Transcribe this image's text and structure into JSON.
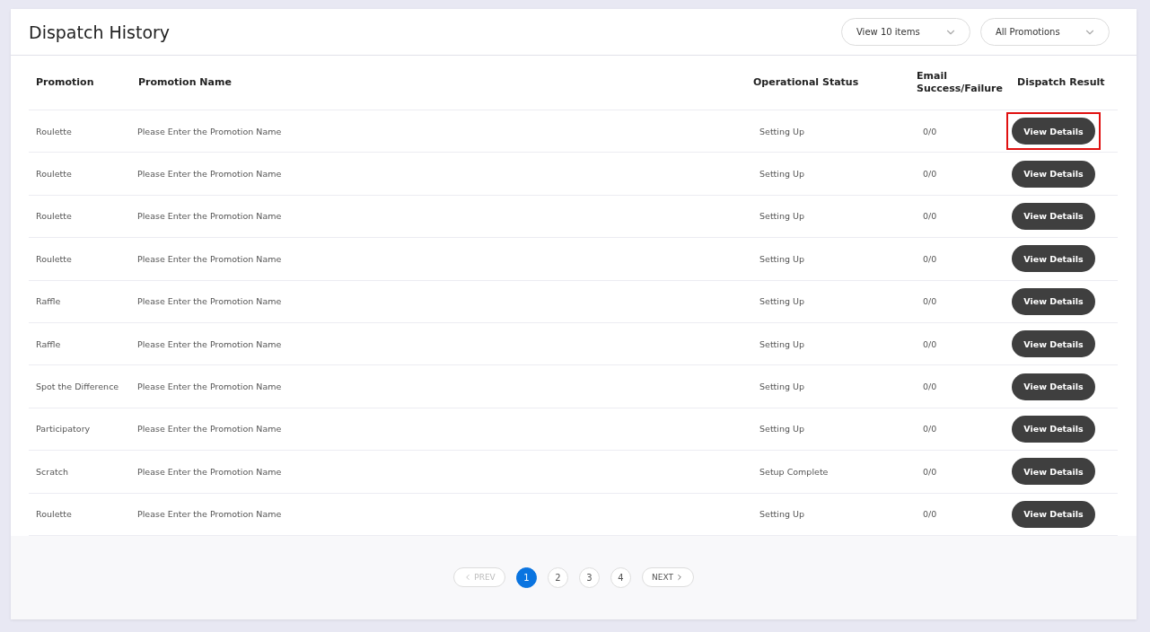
{
  "title": "Dispatch History",
  "filters": [
    {
      "label": "View 10 items"
    },
    {
      "label": "All Promotions"
    }
  ],
  "table": {
    "columns": [
      "Promotion",
      "Promotion Name",
      "Operational Status",
      "Email Success/Failure",
      "Dispatch Result"
    ],
    "rows": [
      {
        "promotion": "Roulette",
        "name": "Please Enter the Promotion Name",
        "status": "Setting Up",
        "email": "0/0",
        "action": "View Details",
        "highlighted": true
      },
      {
        "promotion": "Roulette",
        "name": "Please Enter the Promotion Name",
        "status": "Setting Up",
        "email": "0/0",
        "action": "View Details",
        "highlighted": false
      },
      {
        "promotion": "Roulette",
        "name": "Please Enter the Promotion Name",
        "status": "Setting Up",
        "email": "0/0",
        "action": "View Details",
        "highlighted": false
      },
      {
        "promotion": "Roulette",
        "name": "Please Enter the Promotion Name",
        "status": "Setting Up",
        "email": "0/0",
        "action": "View Details",
        "highlighted": false
      },
      {
        "promotion": "Raffle",
        "name": "Please Enter the Promotion Name",
        "status": "Setting Up",
        "email": "0/0",
        "action": "View Details",
        "highlighted": false
      },
      {
        "promotion": "Raffle",
        "name": "Please Enter the Promotion Name",
        "status": "Setting Up",
        "email": "0/0",
        "action": "View Details",
        "highlighted": false
      },
      {
        "promotion": "Spot the Difference",
        "name": "Please Enter the Promotion Name",
        "status": "Setting Up",
        "email": "0/0",
        "action": "View Details",
        "highlighted": false
      },
      {
        "promotion": "Participatory",
        "name": "Please Enter the Promotion Name",
        "status": "Setting Up",
        "email": "0/0",
        "action": "View Details",
        "highlighted": false
      },
      {
        "promotion": "Scratch",
        "name": "Please Enter the Promotion Name",
        "status": "Setup Complete",
        "email": "0/0",
        "action": "View Details",
        "highlighted": false
      },
      {
        "promotion": "Roulette",
        "name": "Please Enter the Promotion Name",
        "status": "Setting Up",
        "email": "0/0",
        "action": "View Details",
        "highlighted": false
      }
    ]
  },
  "pagination": {
    "prev": {
      "label": "PREV",
      "disabled": true
    },
    "pages": [
      {
        "label": "1",
        "selected": true
      },
      {
        "label": "2",
        "selected": false
      },
      {
        "label": "3",
        "selected": false
      },
      {
        "label": "4",
        "selected": false
      }
    ],
    "next": {
      "label": "NEXT",
      "disabled": false
    }
  }
}
